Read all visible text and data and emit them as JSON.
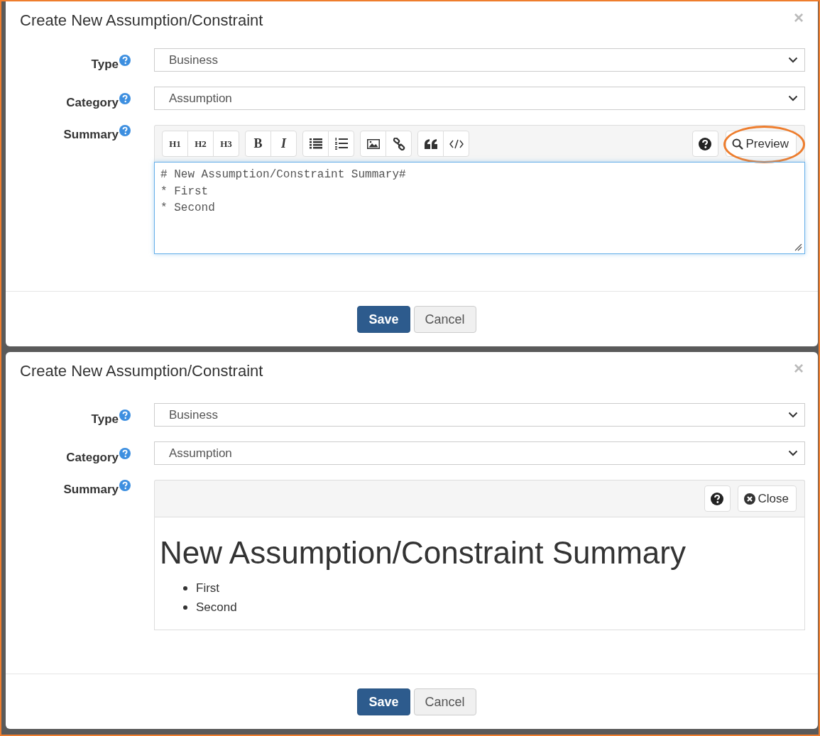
{
  "dialogs": [
    {
      "kind": "edit",
      "title": "Create New Assumption/Constraint",
      "close": "×",
      "fields": [
        {
          "label": "Type",
          "value": "Business"
        },
        {
          "label": "Category",
          "value": "Assumption"
        }
      ],
      "summary": {
        "label": "Summary",
        "toolbar": [
          [
            {
              "kind": "text",
              "label": "H1"
            },
            {
              "kind": "text",
              "label": "H2"
            },
            {
              "kind": "text",
              "label": "H3"
            }
          ],
          [
            {
              "kind": "bold",
              "label": "B"
            },
            {
              "kind": "italic",
              "label": "I"
            }
          ],
          [
            {
              "kind": "bulleted-list"
            },
            {
              "kind": "numbered-list"
            }
          ],
          [
            {
              "kind": "image"
            },
            {
              "kind": "link"
            }
          ],
          [
            {
              "kind": "quote"
            },
            {
              "kind": "code"
            }
          ]
        ],
        "toggle": {
          "label": "Preview",
          "highlighted": true
        },
        "text": "# New Assumption/Constraint Summary#\n* First\n* Second"
      },
      "buttons": [
        {
          "label": "Save",
          "primary": true
        },
        {
          "label": "Cancel",
          "primary": false
        }
      ]
    },
    {
      "kind": "preview",
      "title": "Create New Assumption/Constraint",
      "close": "×",
      "fields": [
        {
          "label": "Type",
          "value": "Business"
        },
        {
          "label": "Category",
          "value": "Assumption"
        }
      ],
      "summary": {
        "label": "Summary",
        "toggle": {
          "label": "Close",
          "highlighted": false
        },
        "heading": "New Assumption/Constraint Summary",
        "items": [
          "First",
          "Second"
        ]
      },
      "buttons": [
        {
          "label": "Save",
          "primary": true
        },
        {
          "label": "Cancel",
          "primary": false
        }
      ]
    }
  ]
}
